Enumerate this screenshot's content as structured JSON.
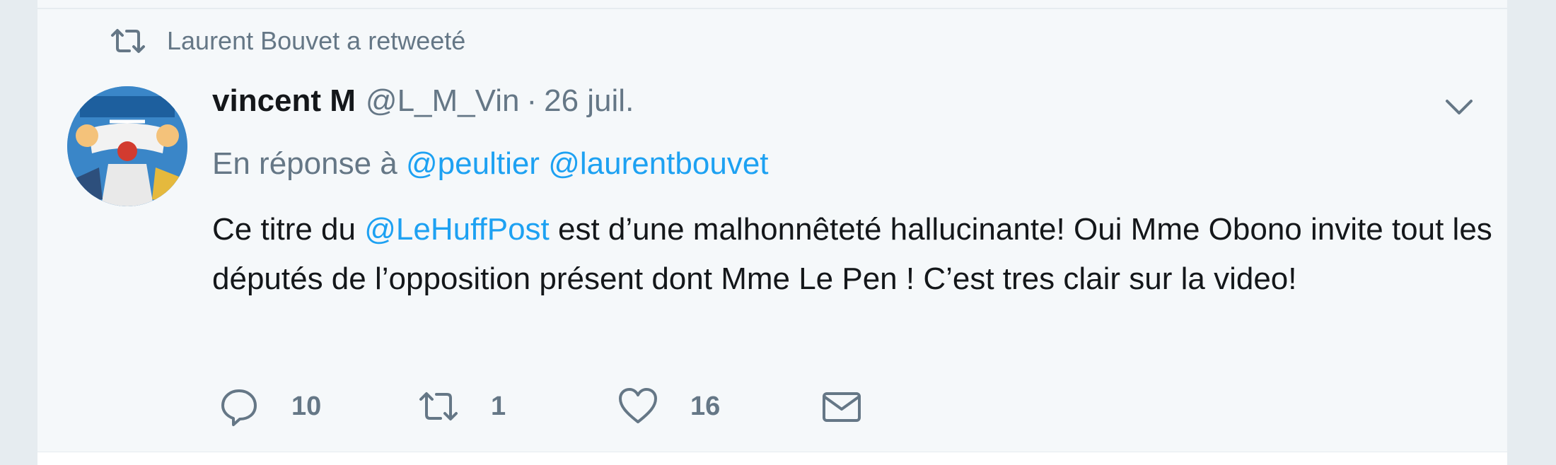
{
  "context": {
    "retweeted_by": "Laurent Bouvet a retweeté",
    "icon": "retweet-icon"
  },
  "tweet": {
    "avatar_icon": "avatar",
    "author_name": "vincent M",
    "author_handle": "@L_M_Vin",
    "separator": "·",
    "date": "26 juil.",
    "reply_prefix": "En réponse à",
    "reply_mentions": [
      "@peultier",
      "@laurentbouvet"
    ],
    "text_before": "Ce titre du ",
    "text_mention": "@LeHuffPost",
    "text_after": " est d’une malhonnêteté hallucinante! Oui Mme Obono invite tout les députés de l’opposition présent dont Mme Le Pen ! C’est tres clair sur la video!",
    "menu_icon": "chevron-down-icon"
  },
  "actions": {
    "reply": {
      "icon": "reply-icon",
      "count": "10"
    },
    "retweet": {
      "icon": "retweet-icon",
      "count": "1"
    },
    "like": {
      "icon": "heart-icon",
      "count": "16"
    },
    "dm": {
      "icon": "envelope-icon"
    }
  },
  "colors": {
    "link": "#1da1f2",
    "secondary": "#657786",
    "text": "#14171a",
    "background": "#f5f8fa"
  }
}
